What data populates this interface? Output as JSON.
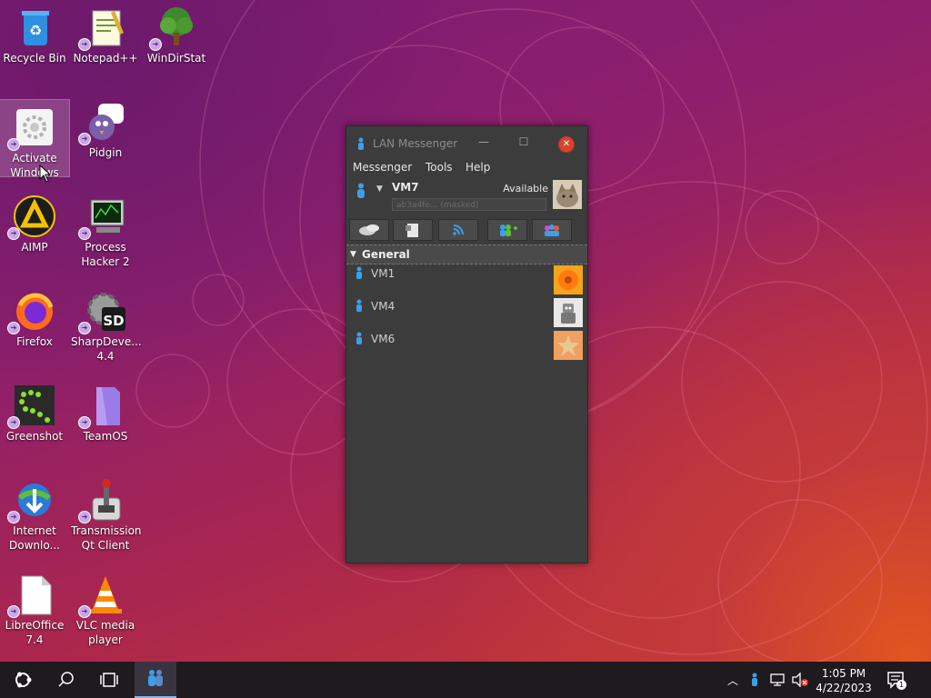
{
  "desktop": {
    "icons": [
      {
        "label": "Recycle Bin",
        "icon": "recycle-bin-icon"
      },
      {
        "label": "Notepad++",
        "icon": "notepad-plus-plus-icon"
      },
      {
        "label": "WinDirStat",
        "icon": "windirstat-tree-icon"
      },
      {
        "label": "Activate Windows",
        "icon": "activate-windows-gear-icon"
      },
      {
        "label": "Pidgin",
        "icon": "pidgin-bird-icon"
      },
      {
        "label": "AIMP",
        "icon": "aimp-icon"
      },
      {
        "label": "Process Hacker 2",
        "icon": "process-hacker-icon"
      },
      {
        "label": "Firefox",
        "icon": "firefox-icon"
      },
      {
        "label": "SharpDeve... 4.4",
        "icon": "sharpdevelop-icon"
      },
      {
        "label": "Greenshot",
        "icon": "greenshot-icon"
      },
      {
        "label": "TeamOS",
        "icon": "teamos-folder-icon"
      },
      {
        "label": "Internet Downlo...",
        "icon": "internet-download-manager-icon"
      },
      {
        "label": "Transmission Qt Client",
        "icon": "transmission-icon"
      },
      {
        "label": "LibreOffice 7.4",
        "icon": "libreoffice-icon"
      },
      {
        "label": "VLC media player",
        "icon": "vlc-cone-icon"
      }
    ]
  },
  "window": {
    "title": "LAN Messenger",
    "controls": {
      "minimize": "—",
      "maximize": "☐",
      "close": "✕"
    },
    "menu": [
      "Messenger",
      "Tools",
      "Help"
    ],
    "user": {
      "name": "VM7",
      "status": "Available",
      "note_placeholder": "ab3a4fe... (masked)"
    },
    "toolbar": [
      "chat-icon",
      "file-transfer-icon",
      "broadcast-icon",
      "add-contact-icon",
      "group-icon"
    ],
    "group": {
      "name": "General"
    },
    "contacts": [
      {
        "name": "VM1",
        "avatar": "flower-avatar"
      },
      {
        "name": "VM4",
        "avatar": "robot-avatar"
      },
      {
        "name": "VM6",
        "avatar": "starfish-avatar"
      }
    ]
  },
  "taskbar": {
    "time": "1:05 PM",
    "date": "4/22/2023",
    "notification_count": "1"
  },
  "colors": {
    "accent": "#d6452b",
    "window_bg": "#3c3c3c",
    "taskbar_bg": "#1e1a1e"
  }
}
